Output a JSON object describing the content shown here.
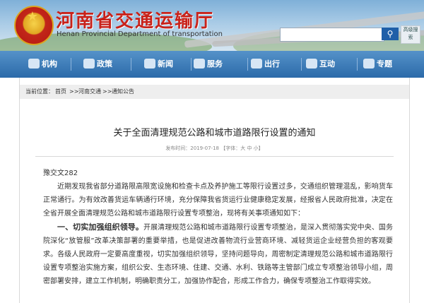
{
  "header": {
    "site_title": "河南省交通运输厅",
    "site_subtitle": "Henan Provincial Department of transportation",
    "search_placeholder": "",
    "side_button_label": "高级搜索"
  },
  "nav": {
    "items": [
      {
        "label": "机构",
        "icon": "building-icon"
      },
      {
        "label": "政策",
        "icon": "document-icon"
      },
      {
        "label": "新闻",
        "icon": "pen-icon"
      },
      {
        "label": "服务",
        "icon": "service-icon"
      },
      {
        "label": "出行",
        "icon": "car-icon"
      },
      {
        "label": "互动",
        "icon": "chat-icon"
      },
      {
        "label": "专题",
        "icon": "star-icon"
      }
    ]
  },
  "breadcrumb": {
    "prefix": "当前位置：",
    "home": "首页",
    "sep1": ">>",
    "section": "河南交通",
    "sep2": ">>",
    "current": "通知公告"
  },
  "article": {
    "title": "关于全面清理规范公路和城市道路限行设置的通知",
    "meta": "发布时间：2019-07-18 【字体：大 中 小】",
    "doc_no": "豫交文282",
    "para1": "近期发现我省部分道路限高限宽设施和检查卡点及养护施工等限行设置过多，交通组织管理混乱，影响货车正常通行。为有效改善货运车辆通行环境，充分保障我省货运行业健康稳定发展，经报省人民政府批准，决定在全省开展全面清理规范公路和城市道路限行设置专项整治，现将有关事项通知如下：",
    "para2_heading": "一、切实加强组织领导。",
    "para2": "开展清理规范公路和城市道路限行设置专项整治，是深入贯彻落实党中央、国务院深化“放管服”改革决策部署的重要举措，也是促进改善物流行业营商环境、减轻货运企业经营负担的客观要求。各级人民政府一定要高度重视，切实加强组织领导，坚持问题导向，周密制定清理规范公路和城市道路限行设置专项整治实施方案，组织公安、生态环境、住建、交通、水利、铁路等主管部门成立专项整治领导小组，周密部署安排，建立工作机制，明确职责分工，加强协作配合，形成工作合力，确保专项整治工作取得实效。"
  },
  "colors": {
    "nav_bg": "#2b6aa9",
    "title_red": "#c8221a",
    "crumb_bg": "#eeeeee"
  }
}
